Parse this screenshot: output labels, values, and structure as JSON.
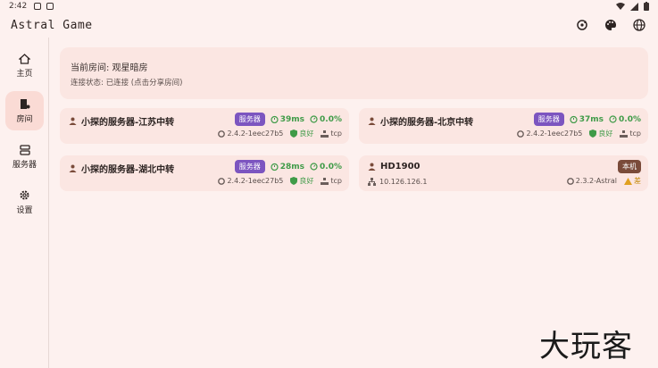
{
  "statusbar": {
    "time": "2:42"
  },
  "app": {
    "title": "Astral Game"
  },
  "nav": [
    {
      "label": "主页"
    },
    {
      "label": "房间"
    },
    {
      "label": "服务器"
    },
    {
      "label": "设置"
    }
  ],
  "room": {
    "name_line": "当前房间: 观星暗房",
    "status_line": "连接状态: 已连接 (点击分享房间)"
  },
  "peers": [
    {
      "name": "小探的服务器-江苏中转",
      "badge": "服务器",
      "ping": "39ms",
      "loss": "0.0%",
      "version": "2.4.2-1eec27b5",
      "quality": "良好",
      "protocol": "tcp"
    },
    {
      "name": "小探的服务器-北京中转",
      "badge": "服务器",
      "ping": "37ms",
      "loss": "0.0%",
      "version": "2.4.2-1eec27b5",
      "quality": "良好",
      "protocol": "tcp"
    },
    {
      "name": "小探的服务器-湖北中转",
      "badge": "服务器",
      "ping": "28ms",
      "loss": "0.0%",
      "version": "2.4.2-1eec27b5",
      "quality": "良好",
      "protocol": "tcp"
    },
    {
      "name": "HD1900",
      "badge": "本机",
      "ip": "10.126.126.1",
      "version": "2.3.2-Astral",
      "quality": "差"
    }
  ],
  "watermark": "大玩客"
}
